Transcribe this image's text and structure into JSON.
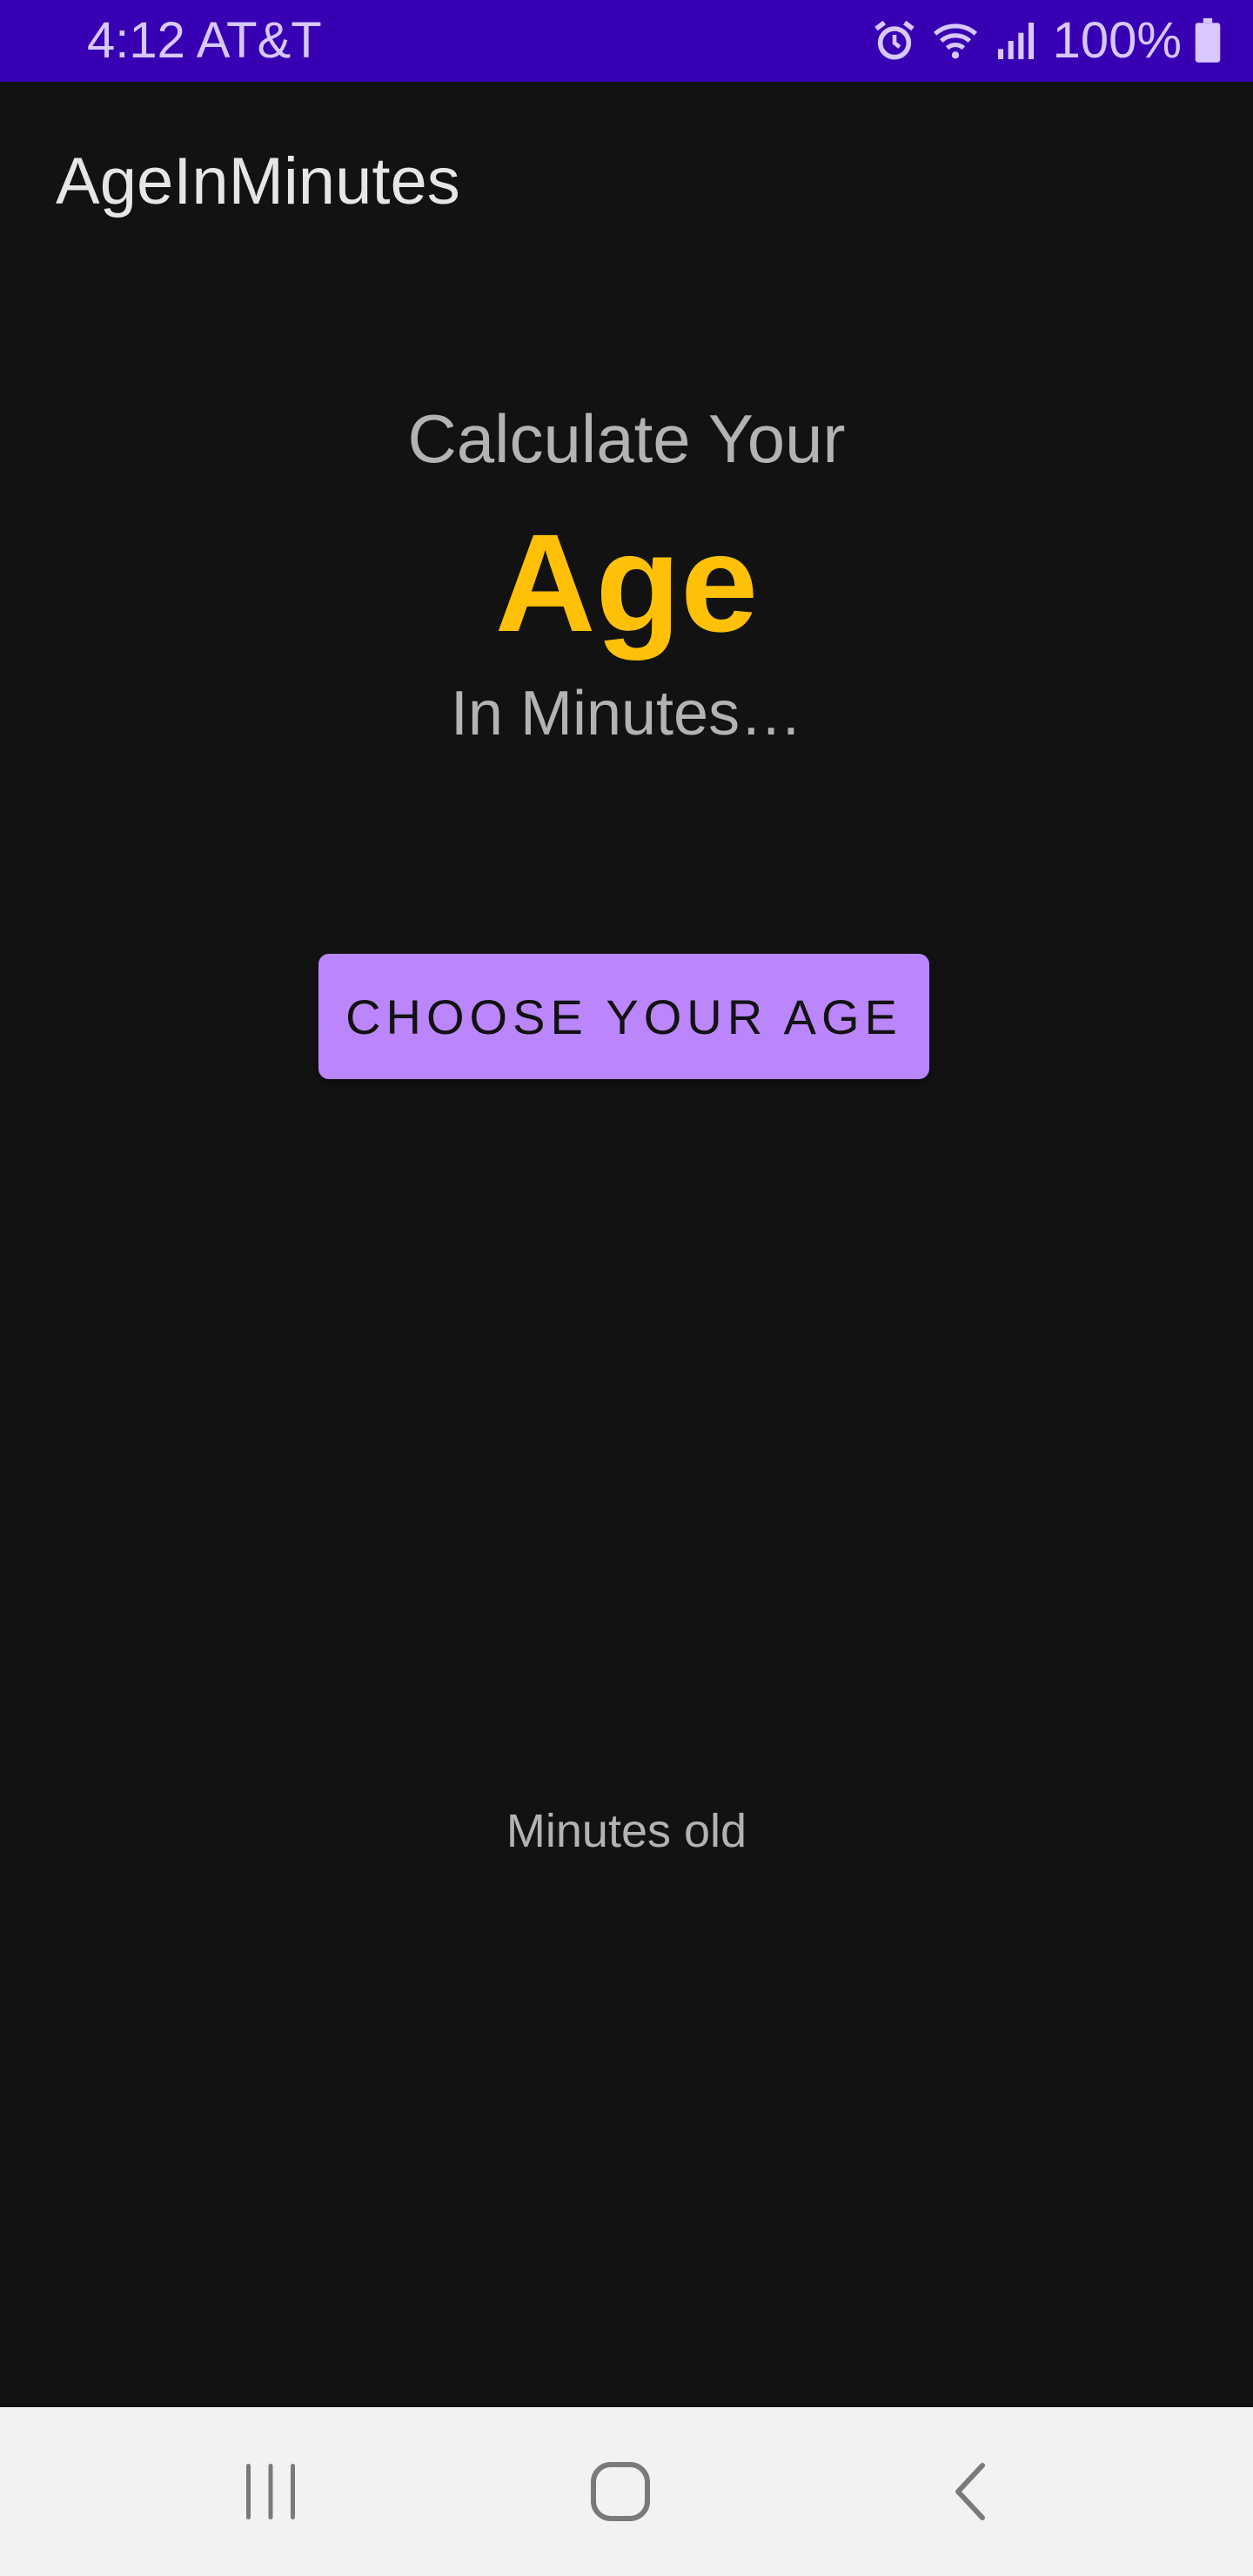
{
  "status_bar": {
    "time_carrier": "4:12 AT&T",
    "battery_percent": "100%",
    "icons": [
      "alarm-icon",
      "wifi-icon",
      "signal-icon",
      "battery-icon"
    ],
    "background": "#3700b3"
  },
  "app_bar": {
    "title": "AgeInMinutes"
  },
  "main": {
    "heading_top": "Calculate Your",
    "heading_emphasis": "Age",
    "heading_bottom": "In Minutes…",
    "choose_button_label": "CHOOSE YOUR AGE",
    "result_label": "Minutes old"
  },
  "nav_bar": {
    "buttons": [
      "recents-icon",
      "home-icon",
      "back-icon"
    ]
  },
  "colors": {
    "accent": "#bb86fc",
    "emphasis": "#ffc107",
    "background": "#121212",
    "text_secondary": "#b3b3b3"
  }
}
